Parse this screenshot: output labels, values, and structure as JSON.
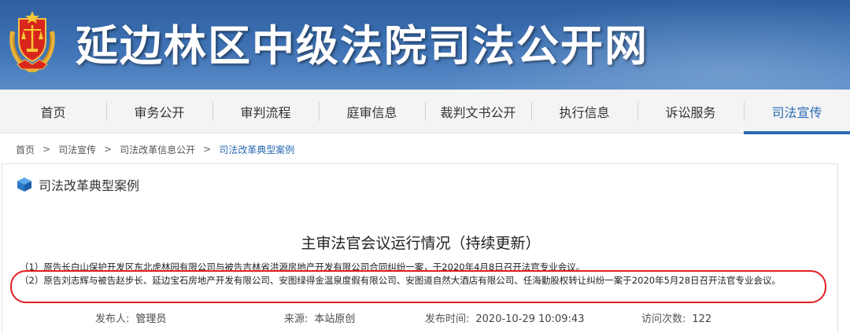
{
  "site": {
    "title": "延边林区中级法院司法公开网"
  },
  "nav": {
    "items": [
      {
        "label": "首页"
      },
      {
        "label": "审务公开"
      },
      {
        "label": "审判流程"
      },
      {
        "label": "庭审信息"
      },
      {
        "label": "裁判文书公开"
      },
      {
        "label": "执行信息"
      },
      {
        "label": "诉讼服务"
      },
      {
        "label": "司法宣传"
      }
    ],
    "active_index": 7,
    "active_color": "#2a6bb3"
  },
  "breadcrumb": {
    "items": [
      "首页",
      "司法宣传",
      "司法改革信息公开",
      "司法改革典型案例"
    ],
    "separator": ">"
  },
  "panel": {
    "title": "司法改革典型案例",
    "icon": "cube-icon"
  },
  "article": {
    "title": "主审法官会议运行情况（持续更新）",
    "para1": "（1）原告长白山保护开发区东北虎林园有限公司与被告吉林省洪源房地产开发有限公司合同纠纷一案，于2020年4月8日召开法官专业会议。",
    "para2": "（2）原告刘志辉与被告赵步长、延边宝石房地产开发有限公司、安图绿得金温泉度假有限公司、安图道自然大酒店有限公司、任海勤股权转让纠纷一案于2020年5月28日召开法官专业会议。",
    "highlight_color": "#e02020"
  },
  "meta": {
    "publisher_label": "发布人:",
    "publisher": "管理员",
    "source_label": "来源:",
    "source": "本站原创",
    "time_label": "发布时间:",
    "time": "2020-10-29 10:09:43",
    "visits_label": "访问次数:",
    "visits": "122"
  }
}
